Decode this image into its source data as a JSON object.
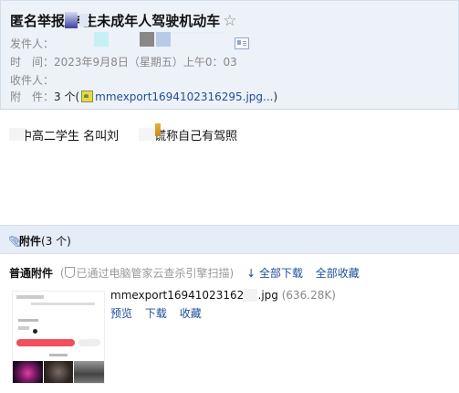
{
  "header": {
    "subject": "匿名举报 学生未成年人驾驶机动车",
    "star": "☆",
    "from_label": "发件人：",
    "time_label": "时　间：",
    "time_value": "2023年9月8日（星期五）上午0：03",
    "to_label": "收件人：",
    "attach_label": "附　件：",
    "attach_count": "3 个",
    "attach_link": "mmexport1694102316295.jpg..."
  },
  "body": {
    "text": "中高二学生 名叫刘　　还谎称自己有驾照"
  },
  "attachments_bar": {
    "title": "附件",
    "count": "(3 个)"
  },
  "normal_attachments": {
    "label": "普通附件",
    "scan_note": "已通过电脑管家云查杀引擎扫描",
    "download_all": "全部下载",
    "save_all": "全部收藏"
  },
  "file": {
    "name": "mmexport1694102316295.jpg",
    "size": "(636.28K)",
    "preview": "预览",
    "download": "下载",
    "save": "收藏"
  }
}
